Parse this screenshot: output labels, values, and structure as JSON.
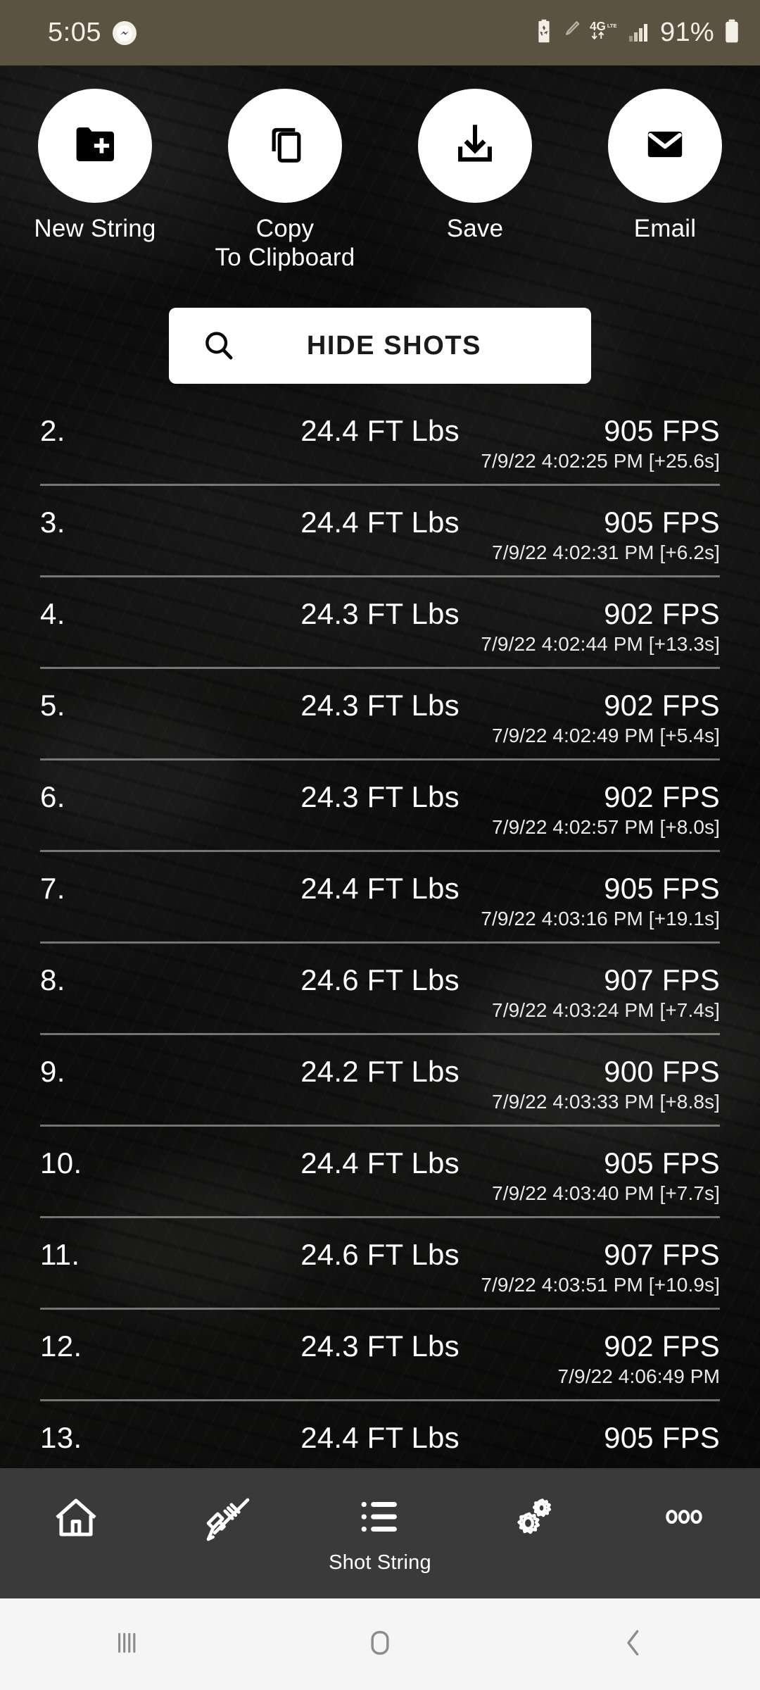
{
  "status_bar": {
    "time": "5:05",
    "messenger_icon": "messenger-icon",
    "battery_saver_icon": "battery-recycle-icon",
    "pen_icon": "pen-icon",
    "network_icon": "4g-lte-data-icon",
    "signal_icon": "signal-bars-icon",
    "battery_percent": "91%",
    "battery_icon": "battery-icon",
    "bg_color": "#5c5241"
  },
  "actions": [
    {
      "label": "New String",
      "icon": "folder-plus-icon"
    },
    {
      "label": "Copy\nTo Clipboard",
      "label_line1": "Copy",
      "label_line2": "To Clipboard",
      "icon": "copy-icon"
    },
    {
      "label": "Save",
      "icon": "download-icon"
    },
    {
      "label": "Email",
      "icon": "envelope-icon"
    }
  ],
  "search": {
    "icon": "search-icon",
    "label": "HIDE SHOTS"
  },
  "shot_string": {
    "columns": [
      "index",
      "energy",
      "velocity",
      "timestamp"
    ],
    "rows": [
      {
        "index": "2.",
        "energy": "24.4 FT Lbs",
        "velocity": "905 FPS",
        "timestamp": "7/9/22 4:02:25 PM [+25.6s]"
      },
      {
        "index": "3.",
        "energy": "24.4 FT Lbs",
        "velocity": "905 FPS",
        "timestamp": "7/9/22 4:02:31 PM [+6.2s]"
      },
      {
        "index": "4.",
        "energy": "24.3 FT Lbs",
        "velocity": "902 FPS",
        "timestamp": "7/9/22 4:02:44 PM [+13.3s]"
      },
      {
        "index": "5.",
        "energy": "24.3 FT Lbs",
        "velocity": "902 FPS",
        "timestamp": "7/9/22 4:02:49 PM [+5.4s]"
      },
      {
        "index": "6.",
        "energy": "24.3 FT Lbs",
        "velocity": "902 FPS",
        "timestamp": "7/9/22 4:02:57 PM [+8.0s]"
      },
      {
        "index": "7.",
        "energy": "24.4 FT Lbs",
        "velocity": "905 FPS",
        "timestamp": "7/9/22 4:03:16 PM [+19.1s]"
      },
      {
        "index": "8.",
        "energy": "24.6 FT Lbs",
        "velocity": "907 FPS",
        "timestamp": "7/9/22 4:03:24 PM [+7.4s]"
      },
      {
        "index": "9.",
        "energy": "24.2 FT Lbs",
        "velocity": "900 FPS",
        "timestamp": "7/9/22 4:03:33 PM [+8.8s]"
      },
      {
        "index": "10.",
        "energy": "24.4 FT Lbs",
        "velocity": "905 FPS",
        "timestamp": "7/9/22 4:03:40 PM [+7.7s]"
      },
      {
        "index": "11.",
        "energy": "24.6 FT Lbs",
        "velocity": "907 FPS",
        "timestamp": "7/9/22 4:03:51 PM [+10.9s]"
      },
      {
        "index": "12.",
        "energy": "24.3 FT Lbs",
        "velocity": "902 FPS",
        "timestamp": "7/9/22 4:06:49 PM"
      },
      {
        "index": "13.",
        "energy": "24.4 FT Lbs",
        "velocity": "905 FPS",
        "timestamp": ""
      }
    ]
  },
  "app_nav": {
    "items": [
      {
        "label": "",
        "icon": "home-icon"
      },
      {
        "label": "",
        "icon": "rifle-icon"
      },
      {
        "label": "Shot String",
        "icon": "list-icon",
        "active": true
      },
      {
        "label": "",
        "icon": "gears-icon"
      },
      {
        "label": "",
        "icon": "more-horizontal-icon"
      }
    ],
    "bg_color": "#3a3a3a"
  },
  "system_nav": {
    "recents_icon": "recents-icon",
    "home_icon": "home-square-icon",
    "back_icon": "back-chevron-icon",
    "bg_color": "#f5f5f5"
  }
}
